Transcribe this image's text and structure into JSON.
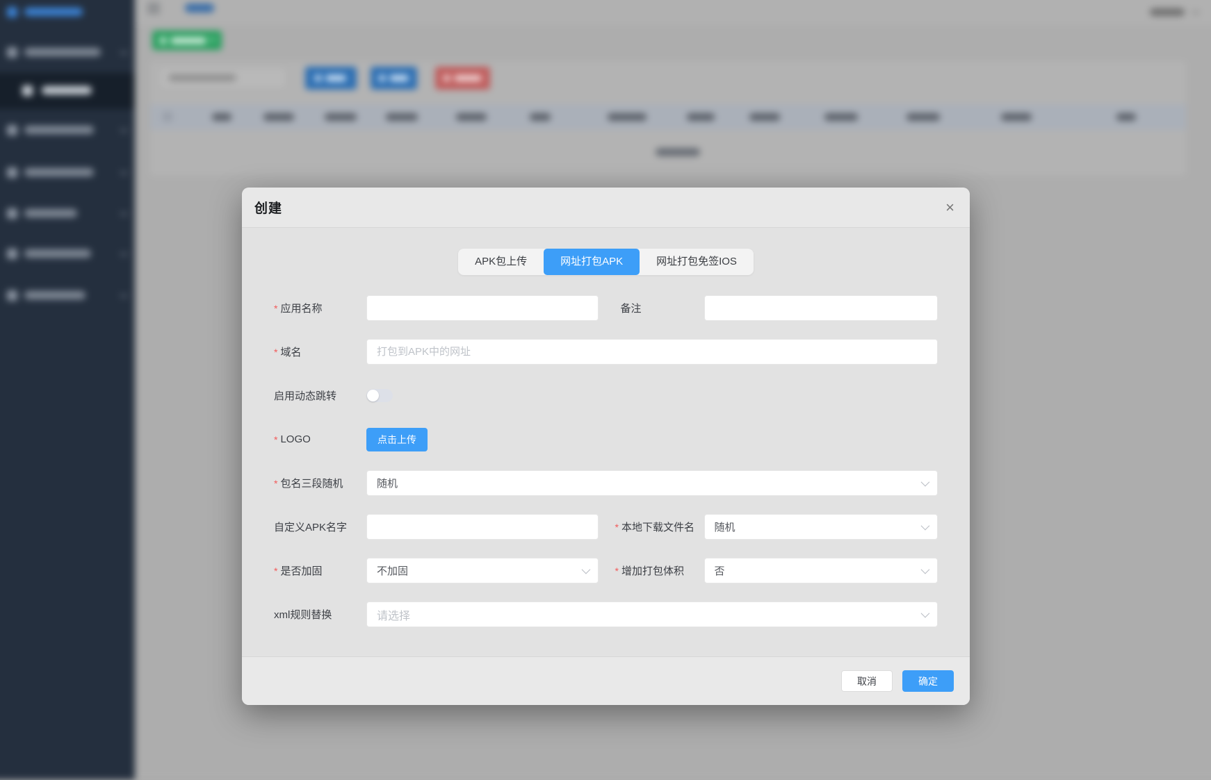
{
  "colors": {
    "primary": "#3d9ef8",
    "required_asterisk": "#f25a5a",
    "sidebar_bg": "#304156",
    "success_button_bg": "#27a05e",
    "danger_button_bg": "#c05d5d",
    "dialog_bg": "#e2e2e2"
  },
  "icons": {
    "close": "×",
    "select_arrow": "chevron-down",
    "hamburger": "menu"
  },
  "modal": {
    "title": "创建",
    "tabs": [
      {
        "label": "APK包上传",
        "active": false
      },
      {
        "label": "网址打包APK",
        "active": true
      },
      {
        "label": "网址打包免签IOS",
        "active": false
      }
    ],
    "fields": {
      "app_name": {
        "label": "应用名称",
        "required": "*",
        "value": ""
      },
      "remark": {
        "label": "备注",
        "value": ""
      },
      "domain": {
        "label": "域名",
        "required": "*",
        "value": "",
        "placeholder": "打包到APK中的网址"
      },
      "dynamic_jump": {
        "label": "启用动态跳转",
        "state": "off"
      },
      "logo": {
        "label": "LOGO",
        "required": "*",
        "upload_button": "点击上传"
      },
      "package_name": {
        "label": "包名三段随机",
        "required": "*",
        "value": "随机"
      },
      "custom_apk_name": {
        "label": "自定义APK名字",
        "value": ""
      },
      "local_filename": {
        "label": "本地下载文件名",
        "required": "*",
        "value": "随机"
      },
      "hardening": {
        "label": "是否加固",
        "required": "*",
        "value": "不加固"
      },
      "package_volume": {
        "label": "增加打包体积",
        "required": "*",
        "value": "否"
      },
      "xml_rule": {
        "label": "xml规则替换",
        "placeholder": "请选择"
      }
    },
    "footer": {
      "cancel": "取消",
      "confirm": "确定"
    }
  }
}
